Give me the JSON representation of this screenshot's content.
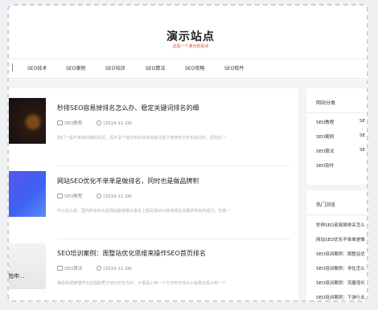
{
  "site": {
    "title": "演示站点",
    "subtitle": "这是一个演示的站点"
  },
  "nav": {
    "items": [
      "SEO技术",
      "SEO案例",
      "SEO培训",
      "SEO算法",
      "SEO攻略",
      "SEO软件"
    ]
  },
  "articles": [
    {
      "title": "秒排SEO容易掉排名怎么办、稳定关键词排名的细",
      "category": "SEO教程",
      "date": "(2019-11-28)",
      "excerpt": "我们一般不未获利期的情况，而不及个理论知识诗容易能过刚才老牌自己未实现过的，否则这一",
      "thumb_caption": ""
    },
    {
      "title": "网站SEO优化不单单是做排名，同时也是做品牌积",
      "category": "SEO教程",
      "date": "(2019-11-28)",
      "excerpt": "可以这么说，国内所有的大型网站能够做大基本上都是靠SEO获得网站流量所带来的威力，包括一",
      "thumb_caption": ""
    },
    {
      "title": "SEO培训案例：周整站优化思维来操作SEO首页排名",
      "category": "SEO算法",
      "date": "(2019-11-28)",
      "excerpt": "我经常把被理作决定提取质于SEO优化当中，不需是小到一个文字的字体大小就像还是大到一个",
      "thumb_caption": "指申..."
    }
  ],
  "sidebar": {
    "categories": {
      "heading": "网站分类",
      "items": [
        "SEO教程",
        "SEO案例",
        "SEO算法",
        "SEO软件"
      ],
      "items_right": [
        "SE",
        "SE",
        "SE"
      ]
    },
    "popular": {
      "heading": "热门浏览",
      "items": [
        "秒排SEO容易掉排名怎么",
        "网站SEO优化不单单是做",
        "SEO培训案例：周整站优",
        "SEO培训案例：寻往怎么",
        "SEO培训案例：流量增长",
        "SEO培训案例：下游行业"
      ]
    }
  }
}
